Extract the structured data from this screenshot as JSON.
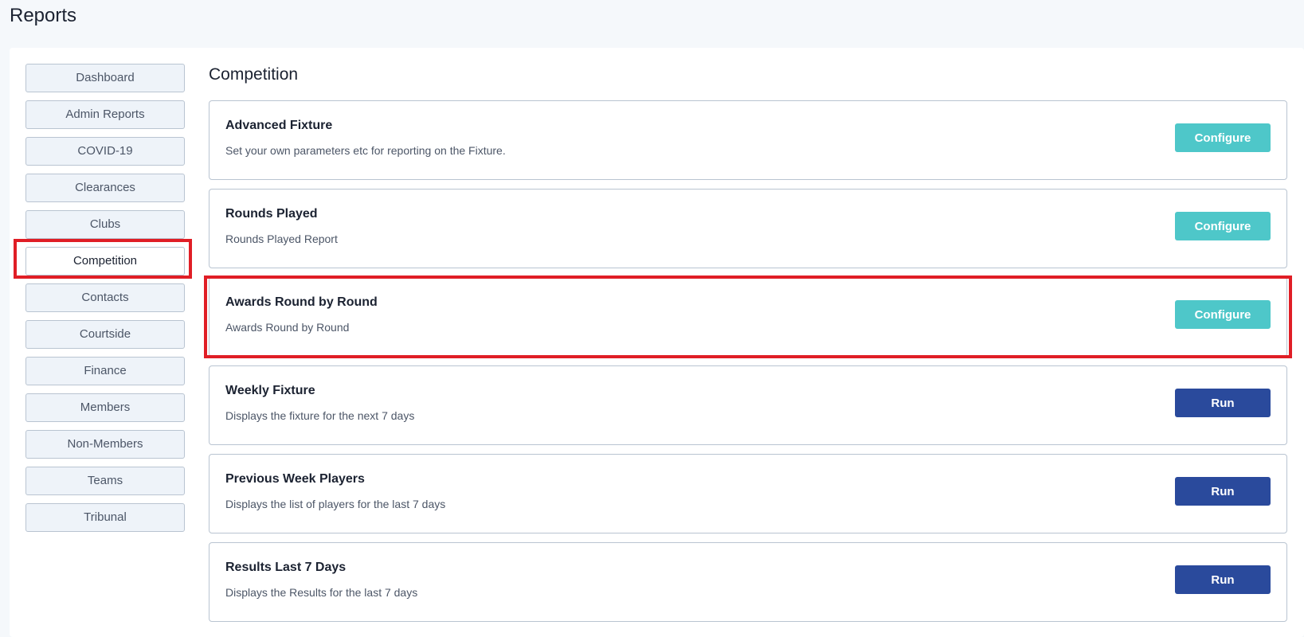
{
  "page": {
    "title": "Reports"
  },
  "sidebar": {
    "items": [
      {
        "label": "Dashboard",
        "active": false
      },
      {
        "label": "Admin Reports",
        "active": false
      },
      {
        "label": "COVID-19",
        "active": false
      },
      {
        "label": "Clearances",
        "active": false
      },
      {
        "label": "Clubs",
        "active": false
      },
      {
        "label": "Competition",
        "active": true
      },
      {
        "label": "Contacts",
        "active": false
      },
      {
        "label": "Courtside",
        "active": false
      },
      {
        "label": "Finance",
        "active": false
      },
      {
        "label": "Members",
        "active": false
      },
      {
        "label": "Non-Members",
        "active": false
      },
      {
        "label": "Teams",
        "active": false
      },
      {
        "label": "Tribunal",
        "active": false
      }
    ]
  },
  "main": {
    "section_title": "Competition",
    "reports": [
      {
        "name": "Advanced Fixture",
        "description": "Set your own parameters etc for reporting on the Fixture.",
        "action": "Configure"
      },
      {
        "name": "Rounds Played",
        "description": "Rounds Played Report",
        "action": "Configure"
      },
      {
        "name": "Awards Round by Round",
        "description": "Awards Round by Round",
        "action": "Configure"
      },
      {
        "name": "Weekly Fixture",
        "description": "Displays the fixture for the next 7 days",
        "action": "Run"
      },
      {
        "name": "Previous Week Players",
        "description": "Displays the list of players for the last 7 days",
        "action": "Run"
      },
      {
        "name": "Results Last 7 Days",
        "description": "Displays the Results for the last 7 days",
        "action": "Run"
      }
    ]
  },
  "colors": {
    "configure_button": "#4ec7c9",
    "run_button": "#2a4a9c",
    "highlight": "#e01e26",
    "background": "#f5f8fb"
  }
}
